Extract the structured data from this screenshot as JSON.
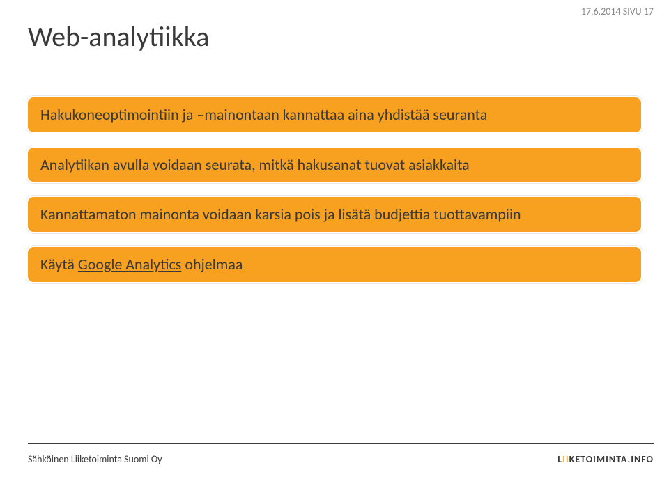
{
  "header": {
    "date_page": "17.6.2014 SIVU 17"
  },
  "title": "Web-analytiikka",
  "boxes": [
    {
      "text": "Hakukoneoptimointiin ja –mainontaan kannattaa aina yhdistää seuranta"
    },
    {
      "text": "Analytiikan avulla voidaan seurata, mitkä hakusanat tuovat asiakkaita"
    },
    {
      "text": "Kannattamaton mainonta voidaan karsia pois ja lisätä budjettia tuottavampiin"
    },
    {
      "prefix": "Käytä ",
      "link": "Google Analytics",
      "suffix": " ohjelmaa"
    }
  ],
  "footer": {
    "left": "Sähköinen Liiketoiminta Suomi Oy",
    "right_pre": "L",
    "right_mid": "II",
    "right_post": "KETOIMINTA.INFO"
  }
}
